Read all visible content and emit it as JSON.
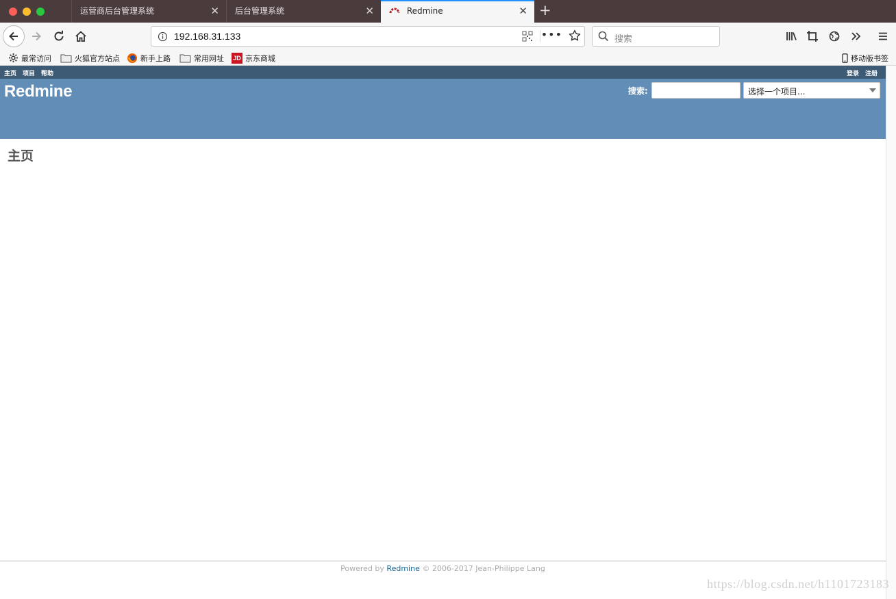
{
  "browser": {
    "tabs": [
      {
        "label": "运营商后台管理系统"
      },
      {
        "label": "后台管理系统"
      },
      {
        "label": "Redmine"
      }
    ],
    "new_tab_glyph": "+",
    "url": "192.168.31.133",
    "more_glyph": "•••",
    "search_placeholder": "搜索",
    "bookmarks": [
      {
        "label": "最常访问",
        "icon": "gear-icon"
      },
      {
        "label": "火狐官方站点",
        "icon": "folder-icon"
      },
      {
        "label": "新手上路",
        "icon": "firefox-icon"
      },
      {
        "label": "常用网址",
        "icon": "folder-icon"
      },
      {
        "label": "京东商城",
        "icon": "jd-icon"
      }
    ],
    "jd_logo_text": "JD",
    "mobile_bookmarks": "移动版书签"
  },
  "redmine": {
    "top_menu": {
      "home": "主页",
      "projects": "项目",
      "help": "帮助",
      "login": "登录",
      "register": "注册"
    },
    "site_title": "Redmine",
    "search_label": "搜索:",
    "project_jump": "选择一个项目...",
    "page_heading": "主页",
    "footer": {
      "powered_by": "Powered by",
      "link": "Redmine",
      "copyright": "© 2006-2017 Jean-Philippe Lang"
    }
  },
  "watermark": "https://blog.csdn.net/h1101723183",
  "colors": {
    "top_menu_bg": "#3e5b76",
    "header_bg": "#628db6",
    "tabbar_bg": "#4a3b3d",
    "link": "#116699"
  }
}
